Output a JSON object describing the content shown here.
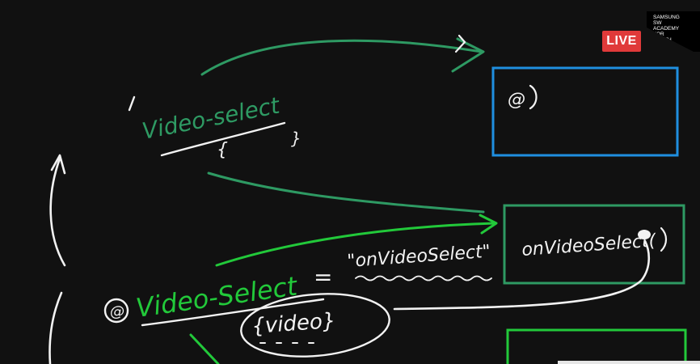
{
  "overlay": {
    "live_label": "LIVE",
    "logo_text": "SAMSUNG\nSW\nACADEMY\nFOR\nYOUTH"
  },
  "whiteboard": {
    "top_event": "Video-select",
    "top_event_payload": "{",
    "top_event_payload_close": "}",
    "blue_box_text": "@",
    "bottom_event": "Video-Select",
    "at_symbol": "@",
    "equals": "=",
    "handler_string": "\"onVideoSelect\"",
    "handler_call": "onVideoSelect(",
    "payload_bubble": "{video}"
  },
  "colors": {
    "board_bg": "#111111",
    "teal_green": "#2e9a63",
    "bright_green": "#22c93a",
    "blue": "#1f8fe0",
    "white": "#f2f2f2",
    "live_red": "#e03a3a"
  }
}
